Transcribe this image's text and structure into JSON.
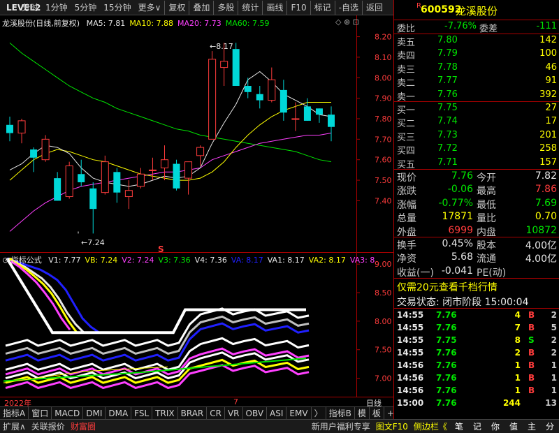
{
  "toolbar": {
    "logo": "LEVEL2",
    "items": [
      "分时",
      "1分钟",
      "5分钟",
      "15分钟",
      "更多∨",
      "复权",
      "叠加",
      "多股",
      "统计",
      "画线",
      "F10",
      "标记",
      "-自选",
      "返回"
    ]
  },
  "main": {
    "title": "龙溪股份(日线,前复权)",
    "ma": [
      {
        "label": "MA5: 7.81",
        "color": "#e8e8e8"
      },
      {
        "label": "MA10: 7.88",
        "color": "#ffff00"
      },
      {
        "label": "MA20: 7.73",
        "color": "#ff40ff"
      },
      {
        "label": "MA60: 7.59",
        "color": "#00e600"
      }
    ],
    "y_ticks": [
      "8.20",
      "8.10",
      "8.00",
      "7.90",
      "7.80",
      "7.70",
      "7.60",
      "7.50",
      "7.40"
    ],
    "high_label": "8.17",
    "low_label": "7.24",
    "s_marker": "S"
  },
  "indicator": {
    "title": "指标公式",
    "legend": [
      {
        "label": "V1: 7.77",
        "color": "#e8e8e8"
      },
      {
        "label": "VB: 7.24",
        "color": "#ffff00"
      },
      {
        "label": "V2: 7.24",
        "color": "#ff40ff"
      },
      {
        "label": "V3: 7.36",
        "color": "#00e600"
      },
      {
        "label": "V4: 7.36",
        "color": "#e8e8e8"
      },
      {
        "label": "VA: 8.17",
        "color": "#2020ff"
      },
      {
        "label": "VA1: 8.17",
        "color": "#e8e8e8"
      },
      {
        "label": "VA2: 8.17",
        "color": "#ffff00"
      },
      {
        "label": "VA3: 8",
        "color": "#ff40ff"
      }
    ],
    "y_ticks": [
      "9.00",
      "8.50",
      "8.00",
      "7.50",
      "7.00"
    ]
  },
  "timebar": {
    "year": "2022年",
    "month": "7",
    "right": "日线"
  },
  "tabs": [
    "指标A",
    "窗口",
    "MACD",
    "DMI",
    "DMA",
    "FSL",
    "TRIX",
    "BRAR",
    "CR",
    "VR",
    "OBV",
    "ASI",
    "EMV",
    "〉",
    "指标B",
    "模",
    "板"
  ],
  "tab_right": [
    "+",
    "−"
  ],
  "statusbar": {
    "left": [
      "扩展∧",
      "关联报价",
      "财富圈"
    ],
    "right": [
      "新用户福利专享",
      "图文F10",
      "侧边栏《"
    ],
    "icons": [
      "笔",
      "记",
      "你",
      "值",
      "主",
      "分"
    ]
  },
  "quote": {
    "code": "600592",
    "name": "龙溪股份",
    "r": "R",
    "webi": {
      "label": "委比",
      "value": "-7.76%",
      "label2": "委差",
      "value2": "-111"
    },
    "sells": [
      {
        "label": "卖五",
        "price": "7.80",
        "vol": "142"
      },
      {
        "label": "卖四",
        "price": "7.79",
        "vol": "100"
      },
      {
        "label": "卖三",
        "price": "7.78",
        "vol": "46"
      },
      {
        "label": "卖二",
        "price": "7.77",
        "vol": "91"
      },
      {
        "label": "卖一",
        "price": "7.76",
        "vol": "392"
      }
    ],
    "buys": [
      {
        "label": "买一",
        "price": "7.75",
        "vol": "27"
      },
      {
        "label": "买二",
        "price": "7.74",
        "vol": "17"
      },
      {
        "label": "买三",
        "price": "7.73",
        "vol": "201"
      },
      {
        "label": "买四",
        "price": "7.72",
        "vol": "258"
      },
      {
        "label": "买五",
        "price": "7.71",
        "vol": "157"
      }
    ],
    "stats": [
      {
        "l1": "现价",
        "v1": "7.76",
        "c1": "green",
        "l2": "今开",
        "v2": "7.82",
        "c2": "white"
      },
      {
        "l1": "涨跌",
        "v1": "-0.06",
        "c1": "green",
        "l2": "最高",
        "v2": "7.86",
        "c2": "red"
      },
      {
        "l1": "涨幅",
        "v1": "-0.77%",
        "c1": "green",
        "l2": "最低",
        "v2": "7.69",
        "c2": "green"
      },
      {
        "l1": "总量",
        "v1": "17871",
        "c1": "yellow",
        "l2": "量比",
        "v2": "0.70",
        "c2": "yellow"
      },
      {
        "l1": "外盘",
        "v1": "6999",
        "c1": "red",
        "l2": "内盘",
        "v2": "10872",
        "c2": "green"
      }
    ],
    "stats2": [
      {
        "l1": "换手",
        "v1": "0.45%",
        "l2": "股本",
        "v2": "4.00亿"
      },
      {
        "l1": "净资",
        "v1": "5.68",
        "l2": "流通",
        "v2": "4.00亿"
      },
      {
        "l1": "收益(一)",
        "v1": "-0.041",
        "l2": "PE(动)",
        "v2": ""
      }
    ],
    "promo": "仅需20元查看千档行情",
    "trade_status": "交易状态: 闭市阶段 15:00:04",
    "ticks": [
      {
        "t": "14:55",
        "p": "7.76",
        "v": "4",
        "s": "B",
        "n": "2",
        "pc": "green",
        "sc": "red"
      },
      {
        "t": "14:55",
        "p": "7.76",
        "v": "7",
        "s": "B",
        "n": "5",
        "pc": "green",
        "sc": "red"
      },
      {
        "t": "14:55",
        "p": "7.75",
        "v": "8",
        "s": "S",
        "n": "2",
        "pc": "green",
        "sc": "green"
      },
      {
        "t": "14:55",
        "p": "7.76",
        "v": "2",
        "s": "B",
        "n": "2",
        "pc": "green",
        "sc": "red"
      },
      {
        "t": "14:56",
        "p": "7.76",
        "v": "1",
        "s": "B",
        "n": "1",
        "pc": "green",
        "sc": "red"
      },
      {
        "t": "14:56",
        "p": "7.76",
        "v": "1",
        "s": "B",
        "n": "1",
        "pc": "green",
        "sc": "red"
      },
      {
        "t": "14:56",
        "p": "7.76",
        "v": "1",
        "s": "B",
        "n": "1",
        "pc": "green",
        "sc": "red"
      },
      {
        "t": "15:00",
        "p": "7.76",
        "v": "244",
        "s": "",
        "n": "13",
        "pc": "green",
        "sc": "red"
      }
    ]
  },
  "chart_data": {
    "type": "candlestick",
    "ylim": [
      7.18,
      8.27
    ],
    "candles": [
      [
        7.77,
        7.73,
        7.81,
        7.69
      ],
      [
        7.73,
        7.79,
        7.8,
        7.68
      ],
      [
        7.65,
        7.61,
        7.66,
        7.54
      ],
      [
        7.6,
        7.7,
        7.72,
        7.59
      ],
      [
        7.51,
        7.4,
        7.54,
        7.4
      ],
      [
        7.42,
        7.57,
        7.59,
        7.41
      ],
      [
        7.53,
        7.49,
        7.6,
        7.47
      ],
      [
        7.46,
        7.36,
        7.49,
        7.24
      ],
      [
        7.44,
        7.59,
        7.62,
        7.43
      ],
      [
        7.54,
        7.44,
        7.56,
        7.39
      ],
      [
        7.42,
        7.45,
        7.5,
        7.36
      ],
      [
        7.47,
        7.53,
        7.56,
        7.46
      ],
      [
        7.55,
        7.55,
        7.61,
        7.5
      ],
      [
        7.56,
        7.6,
        7.67,
        7.5
      ],
      [
        7.58,
        7.46,
        7.6,
        7.45
      ],
      [
        7.51,
        7.59,
        7.59,
        7.43
      ],
      [
        7.62,
        7.66,
        7.67,
        7.57
      ],
      [
        7.7,
        8.09,
        8.13,
        7.7
      ],
      [
        8.05,
        8.08,
        8.17,
        7.96
      ],
      [
        8.14,
        7.96,
        8.17,
        7.96
      ],
      [
        7.96,
        7.93,
        8.0,
        7.9
      ],
      [
        7.92,
        7.89,
        7.96,
        7.85
      ],
      [
        7.89,
        7.99,
        8.05,
        7.88
      ],
      [
        7.94,
        7.83,
        7.99,
        7.79
      ],
      [
        7.8,
        7.8,
        7.88,
        7.74
      ],
      [
        7.86,
        7.79,
        7.9,
        7.79
      ],
      [
        7.85,
        7.82,
        7.85,
        7.78
      ],
      [
        7.82,
        7.76,
        7.86,
        7.69
      ]
    ],
    "ma5": [
      7.55,
      7.58,
      7.63,
      7.67,
      7.66,
      7.63,
      7.56,
      7.51,
      7.49,
      7.48,
      7.47,
      7.48,
      7.5,
      7.52,
      7.51,
      7.52,
      7.56,
      7.68,
      7.78,
      7.87,
      7.99,
      8.03,
      7.98,
      7.92,
      7.89,
      7.86,
      7.82,
      7.81
    ],
    "ma10": [
      7.5,
      7.55,
      7.6,
      7.63,
      7.65,
      7.64,
      7.62,
      7.6,
      7.59,
      7.57,
      7.55,
      7.53,
      7.52,
      7.51,
      7.5,
      7.5,
      7.51,
      7.54,
      7.59,
      7.66,
      7.72,
      7.77,
      7.81,
      7.84,
      7.86,
      7.88,
      7.88,
      7.88
    ],
    "ma20": [
      7.25,
      7.3,
      7.35,
      7.39,
      7.42,
      7.45,
      7.47,
      7.48,
      7.49,
      7.5,
      7.51,
      7.52,
      7.53,
      7.54,
      7.54,
      7.55,
      7.56,
      7.6,
      7.62,
      7.64,
      7.66,
      7.68,
      7.69,
      7.7,
      7.71,
      7.72,
      7.72,
      7.73
    ],
    "ma60": [
      8.17,
      8.12,
      8.08,
      8.04,
      8.0,
      7.96,
      7.93,
      7.9,
      7.88,
      7.85,
      7.83,
      7.81,
      7.79,
      7.77,
      7.75,
      7.74,
      7.72,
      7.71,
      7.7,
      7.69,
      7.68,
      7.67,
      7.66,
      7.65,
      7.64,
      7.62,
      7.6,
      7.59
    ]
  },
  "indicator_data": {
    "ylim": [
      6.75,
      9.1
    ],
    "lines": [
      {
        "name": "",
        "color": "#2020ff",
        "v": [
          9.1,
          9.05,
          9.0,
          8.95,
          8.9,
          8.82,
          8.72,
          8.55,
          8.3,
          8.05,
          7.9,
          7.8
        ]
      },
      {
        "name": "",
        "color": "#e8e8e8",
        "v": [
          9.1,
          9.02,
          8.95,
          8.85,
          8.75,
          8.6,
          8.4,
          8.15,
          7.95,
          7.8
        ]
      },
      {
        "name": "",
        "color": "#ffff00",
        "v": [
          9.1,
          9.0,
          8.9,
          8.78,
          8.65,
          8.48,
          8.25,
          8.0,
          7.8
        ]
      },
      {
        "name": "",
        "color": "#ff40ff",
        "v": [
          9.05,
          8.95,
          8.82,
          8.68,
          8.5,
          8.3,
          8.05,
          7.85
        ]
      }
    ]
  }
}
